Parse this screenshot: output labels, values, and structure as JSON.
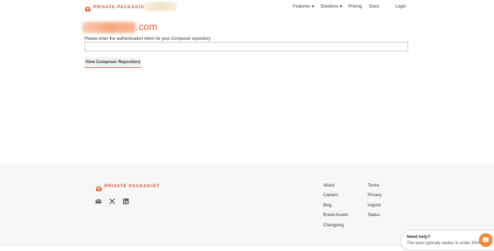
{
  "header": {
    "logo_text": "PRIVATE PACKAGIST",
    "nav": {
      "features": "Features",
      "solutions": "Solutions",
      "pricing": "Pricing",
      "docs": "Docs",
      "login": "Login"
    }
  },
  "main": {
    "domain_suffix": ".com",
    "token_label": "Please enter the authentication token for your Composer repository",
    "token_value": "",
    "view_button": "View Composer Repository"
  },
  "footer": {
    "logo_text": "PRIVATE PACKAGIST",
    "social_icons": [
      "mail-icon",
      "x-icon",
      "linkedin-icon"
    ],
    "col1": [
      "About",
      "Careers",
      "Blog",
      "Brand Assets",
      "Changelog"
    ],
    "col2": [
      "Terms",
      "Privacy",
      "Imprint",
      "Status"
    ]
  },
  "chat": {
    "title": "Need help?",
    "subtitle": "The team typically replies in under 30m"
  },
  "colors": {
    "brand": "#e7632f",
    "footer_bg": "#f7f7f7",
    "chat_button": "#f28a3a"
  }
}
